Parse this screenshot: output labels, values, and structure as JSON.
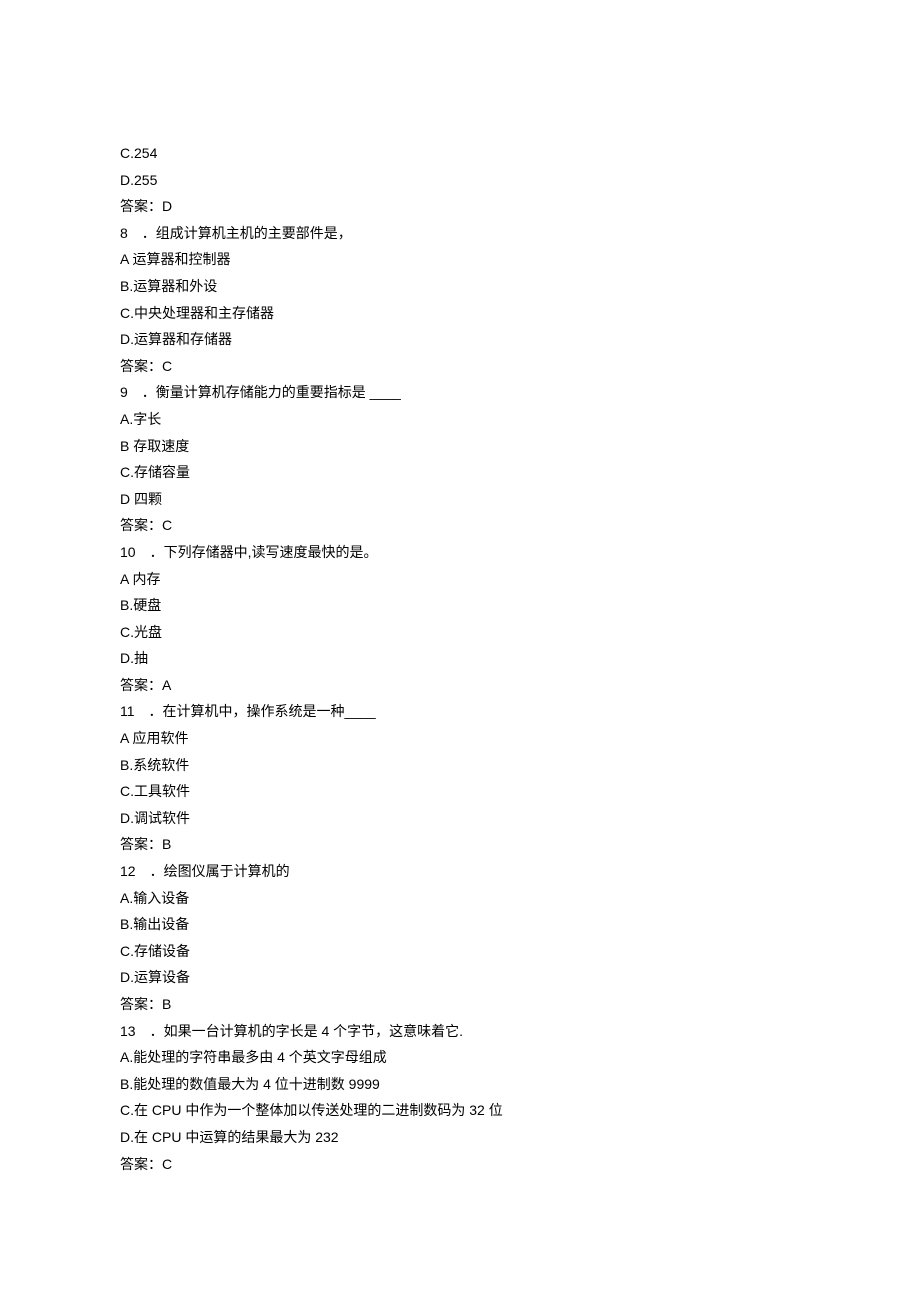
{
  "lines": [
    "C.254",
    "D.255",
    "答案：D",
    "8　．组成计算机主机的主要部件是，",
    "A 运算器和控制器",
    "B.运算器和外设",
    "C.中央处理器和主存储器",
    "D.运算器和存储器",
    "答案：C",
    "9　．衡量计算机存储能力的重要指标是 ____",
    "A.字长",
    "B 存取速度",
    "C.存储容量",
    "D 四颗",
    "答案：C",
    "10　．下列存储器中,读写速度最快的是。",
    "A 内存",
    "B.硬盘",
    "C.光盘",
    "D.抽",
    "答案：A",
    "11　．在计算机中，操作系统是一种____",
    "A 应用软件",
    "B.系统软件",
    "C.工具软件",
    "D.调试软件",
    "答案：B",
    "12　．绘图仪属于计算机的",
    "A.输入设备",
    "B.输出设备",
    "C.存储设备",
    "D.运算设备",
    "答案：B",
    "13　．如果一台计算机的字长是 4 个字节，这意味着它.",
    "A.能处理的字符串最多由 4 个英文字母组成",
    "B.能处理的数值最大为 4 位十进制数 9999",
    "C.在 CPU 中作为一个整体加以传送处理的二进制数码为 32 位",
    "D.在 CPU 中运算的结果最大为 232",
    "答案：C"
  ]
}
